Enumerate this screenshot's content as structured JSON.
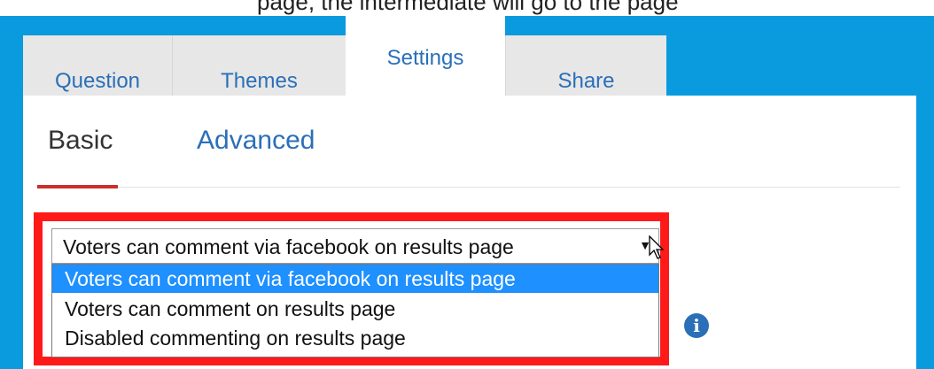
{
  "top_text": "page, the intermediate will go to the page",
  "tabs": [
    {
      "label": "Question"
    },
    {
      "label": "Themes"
    },
    {
      "label": "Settings"
    },
    {
      "label": "Share"
    }
  ],
  "active_tab": "Settings",
  "subtabs": [
    {
      "label": "Basic"
    },
    {
      "label": "Advanced"
    }
  ],
  "active_subtab": "Basic",
  "comment_select": {
    "selected": "Voters can comment via facebook on results page",
    "options": [
      "Voters can comment via facebook on results page",
      "Voters can comment on results page",
      "Disabled commenting on results page"
    ]
  },
  "info_icon": "info-icon",
  "colors": {
    "background": "#0a9ade",
    "tab_inactive": "#e7e7e7",
    "link_blue": "#2a6fb8",
    "underline_red": "#c9302c",
    "highlight_red": "#ff1a1a",
    "option_selected": "#1e90ff"
  }
}
